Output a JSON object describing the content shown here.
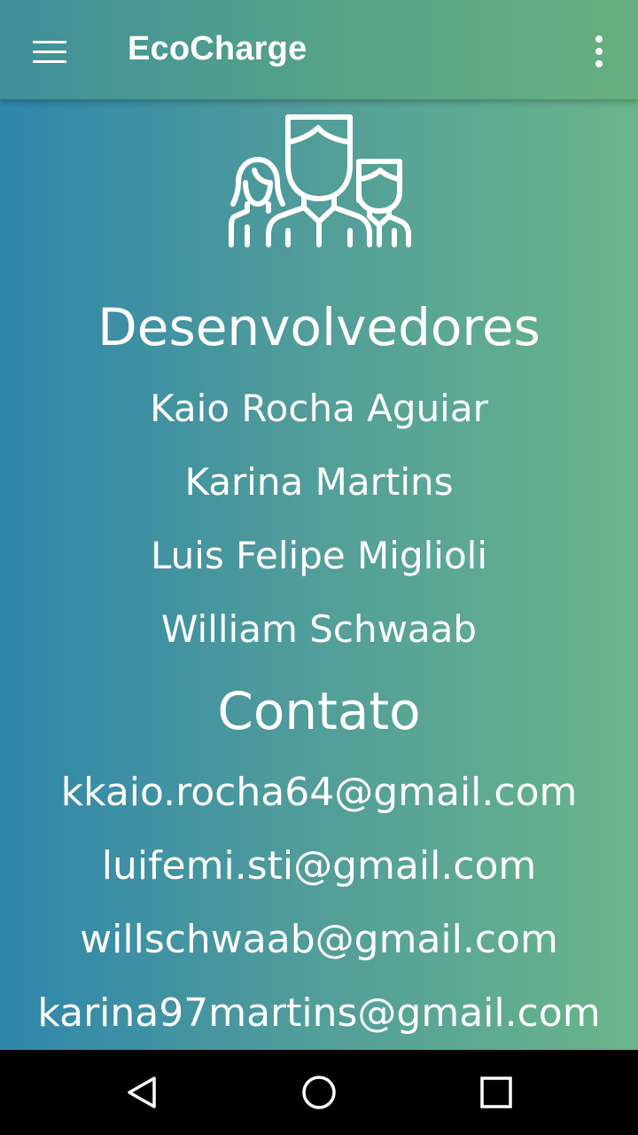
{
  "app_bar": {
    "title": "EcoCharge",
    "menu_icon": "hamburger-menu-icon",
    "overflow_icon": "more-vert-icon"
  },
  "hero_icon": "team-people-icon",
  "developers": {
    "heading": "Desenvolvedores",
    "names": [
      "Kaio Rocha Aguiar",
      "Karina Martins",
      "Luis Felipe Miglioli",
      "William Schwaab"
    ]
  },
  "contact": {
    "heading": "Contato",
    "emails": [
      "kkaio.rocha64@gmail.com",
      "luifemi.sti@gmail.com",
      "willschwaab@gmail.com",
      "karina97martins@gmail.com"
    ]
  },
  "nav_bar": {
    "back_icon": "back-triangle-icon",
    "home_icon": "home-circle-icon",
    "recents_icon": "recents-square-icon"
  },
  "colors": {
    "gradient_left": "#2e86ab",
    "gradient_right": "#6ab58a",
    "app_bar": "#57a487",
    "text": "#ffffff",
    "nav_bar": "#000000"
  }
}
